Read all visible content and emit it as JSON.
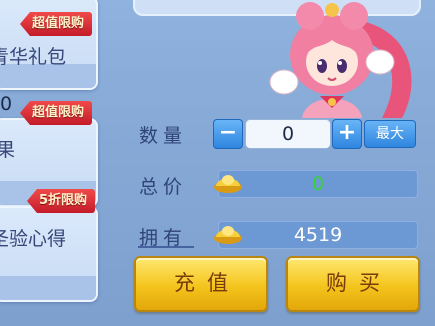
{
  "side_cards": [
    {
      "badge": "超值限购",
      "title": "青华礼包"
    },
    {
      "badge": "超值限购",
      "title": "果",
      "count": "0"
    },
    {
      "badge": "5折限购",
      "title": "圣验心得"
    }
  ],
  "purchase": {
    "quantity_label": "数量",
    "quantity_value": "0",
    "minus_symbol": "−",
    "plus_symbol": "+",
    "max_label": "最大",
    "total_label": "总价",
    "total_value": "0",
    "owned_label": "拥有",
    "owned_value": "4519"
  },
  "buttons": {
    "recharge": "充值",
    "buy": "购买"
  },
  "colors": {
    "total_value": "#3ad23a",
    "badge_red": "#d9202e",
    "gold_button": "#f4c41c",
    "blue_button": "#2f86df"
  }
}
